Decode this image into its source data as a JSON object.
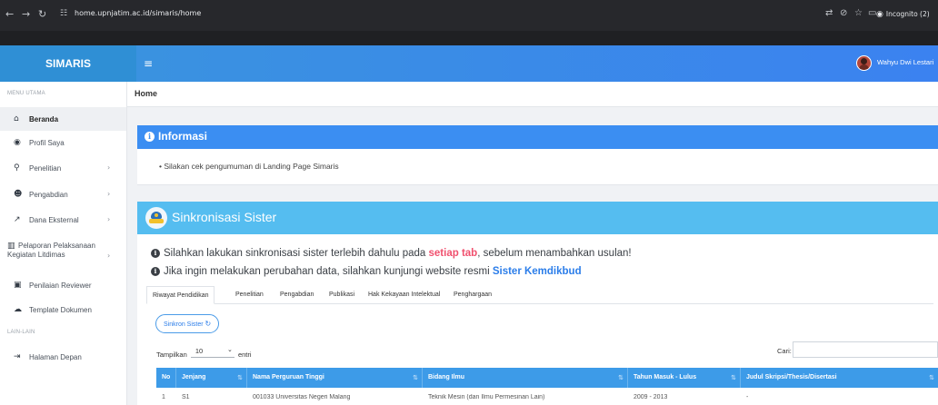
{
  "browser": {
    "url": "home.upnjatim.ac.id/simaris/home",
    "incognito_label": "Incognito (2)"
  },
  "header": {
    "brand": "SIMARIS",
    "menu_icon": "hamburger-icon",
    "user_name": "Wahyu Dwi Lestari"
  },
  "sidebar": {
    "section_main": "MENU UTAMA",
    "items": [
      {
        "label": "Beranda",
        "icon": "home-icon"
      },
      {
        "label": "Profil Saya",
        "icon": "user-circle-icon"
      },
      {
        "label": "Penelitian",
        "icon": "search-icon"
      },
      {
        "label": "Pengabdian",
        "icon": "users-icon"
      },
      {
        "label": "Dana Eksternal",
        "icon": "external-link-icon"
      },
      {
        "label_line1": "Pelaporan Pelaksanaan",
        "label_line2": "Kegiatan Litdimas",
        "icon": "bar-chart-icon"
      },
      {
        "label": "Penilaian Reviewer",
        "icon": "reviewer-icon"
      },
      {
        "label": "Template Dokumen",
        "icon": "cloud-download-icon"
      }
    ],
    "section_other": "LAIN-LAIN",
    "other_items": [
      {
        "label": "Halaman Depan",
        "icon": "sign-in-icon"
      }
    ]
  },
  "breadcrumb": "Home",
  "informasi": {
    "title": "Informasi",
    "items": [
      "Silakan cek pengumuman di Landing Page Simaris"
    ]
  },
  "sister": {
    "title": "Sinkronisasi Sister",
    "notice1_pre": "Silahkan lakukan sinkronisasi sister terlebih dahulu pada ",
    "notice1_highlight": "setiap tab",
    "notice1_post": ", sebelum menambahkan usulan!",
    "notice2_pre": "Jika ingin melakukan perubahan data, silahkan kunjungi website resmi ",
    "notice2_link": "Sister Kemdikbud",
    "tabs": [
      "Riwayat Pendidikan",
      "Penelitian",
      "Pengabdian",
      "Publikasi",
      "Hak Kekayaan Intelektual",
      "Penghargaan"
    ],
    "sync_button": "Sinkron Sister",
    "show_label": "Tampilkan",
    "show_value": "10",
    "entries_label": "entri",
    "search_label": "Cari:",
    "table": {
      "columns": [
        "No",
        "Jenjang",
        "Nama Perguruan Tinggi",
        "Bidang Ilmu",
        "Tahun Masuk - Lulus",
        "Judul Skripsi/Thesis/Disertasi"
      ],
      "rows": [
        [
          "1",
          "S1",
          "001033 Universitas Negeri Malang",
          "Teknik Mesin (dan Ilmu Permesinan Lain)",
          "2009 - 2013",
          "-"
        ]
      ]
    }
  },
  "colors": {
    "brand": "#2f8fd5",
    "info_header": "#3b8ef2",
    "sister_header": "#55bdf0",
    "highlight_red": "#f0506e",
    "link_blue": "#2b7de9",
    "table_header": "#3d9be8"
  }
}
